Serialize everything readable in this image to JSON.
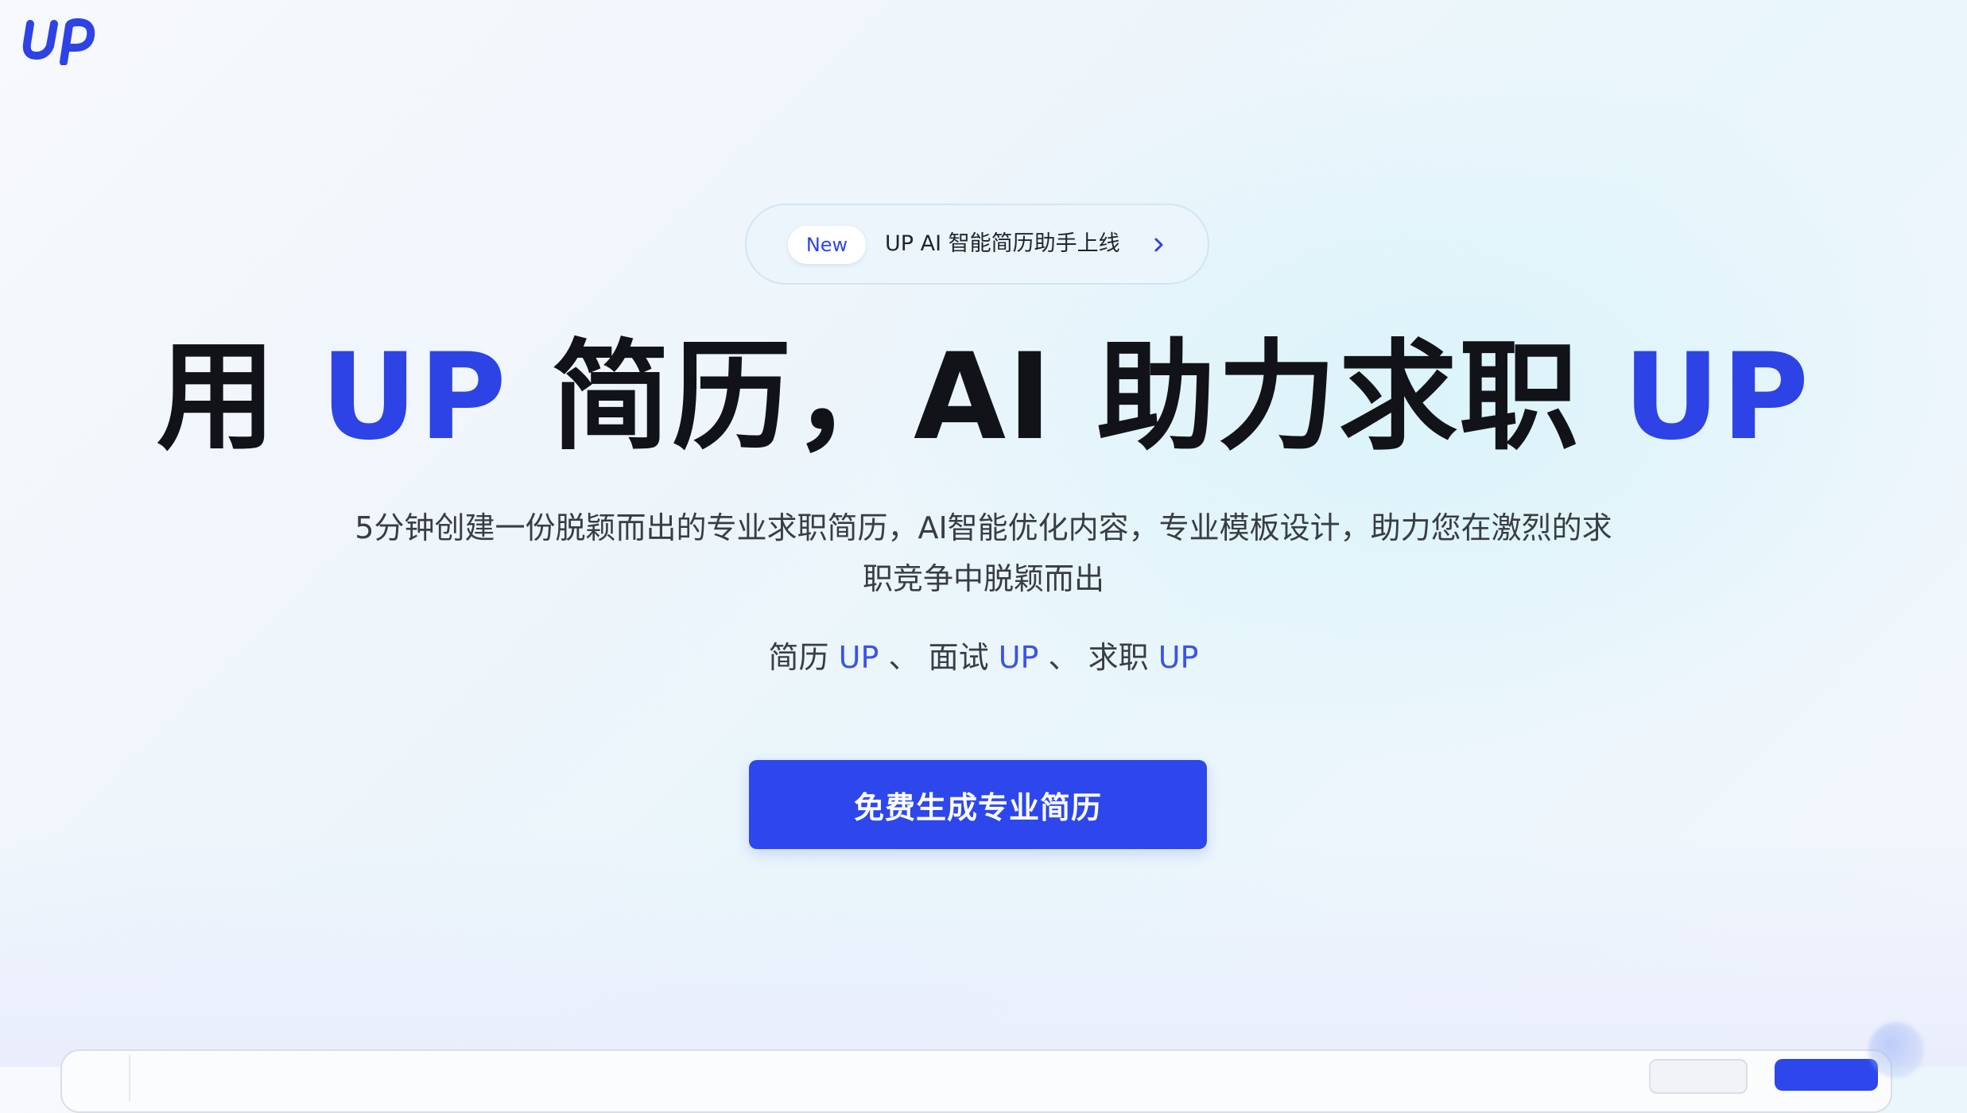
{
  "brand": {
    "logo_text": "UP",
    "accent_color": "#2d43e6"
  },
  "announcement": {
    "badge": "New",
    "text": "UP AI 智能简历助手上线",
    "icon": "chevron-right-icon"
  },
  "hero": {
    "title_part1": "用 ",
    "title_accent1": "UP",
    "title_part2": " 简历，AI 助力求职 ",
    "title_accent2": "UP",
    "subtitle": "5分钟创建一份脱颖而出的专业求职简历，AI智能优化内容，专业模板设计，助力您在激烈的求职竞争中脱颖而出",
    "tagline": [
      {
        "word": "简历",
        "accent": "UP",
        "sep": "、"
      },
      {
        "word": "面试",
        "accent": "UP",
        "sep": "、"
      },
      {
        "word": "求职",
        "accent": "UP",
        "sep": ""
      }
    ]
  },
  "cta": {
    "label": "免费生成专业简历",
    "color": "#2d47ec"
  }
}
